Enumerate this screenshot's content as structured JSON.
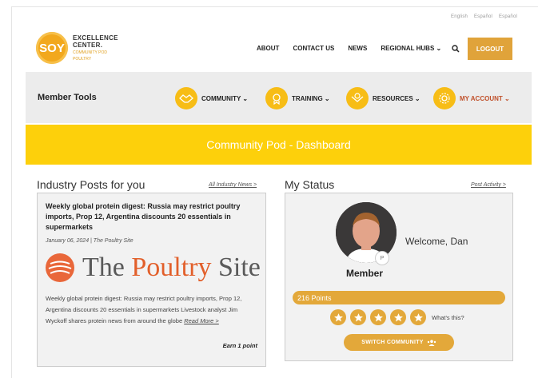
{
  "top_links": [
    "English",
    "Español",
    "Español"
  ],
  "logo": {
    "mark": "SOY",
    "title_line1": "EXCELLENCE",
    "title_line2": "CENTER.",
    "sub_line1": "COMMUNITY POD",
    "sub_line2": "POULTRY"
  },
  "nav": {
    "about": "ABOUT",
    "contact": "CONTACT US",
    "news": "NEWS",
    "regional_hubs": "REGIONAL HUBS ⌄",
    "logout": "LOGOUT"
  },
  "member_tools": {
    "title": "Member Tools",
    "community": "COMMUNITY ⌄",
    "training": "TRAINING ⌄",
    "resources": "RESOURCES ⌄",
    "my_account": "MY ACCOUNT ⌄"
  },
  "banner": {
    "title": "Community Pod - Dashboard"
  },
  "industry_posts": {
    "heading": "Industry Posts for you",
    "all_link": "All Industry News >",
    "post_title": "Weekly global protein digest: Russia may restrict poultry imports, Prop 12, Argentina discounts 20 essentials in supermarkets",
    "meta": "January 06, 2024 | The Poultry Site",
    "source_logo_pre": "The ",
    "source_logo_orange": "Poultry",
    "source_logo_post": " Site",
    "body": "Weekly global protein digest: Russia may restrict poultry imports, Prop 12, Argentina discounts 20 essentials in supermarkets Livestock analyst Jim Wyckoff shares protein news from around the globe ",
    "read_more": "Read More >",
    "earn": "Earn 1 point"
  },
  "my_status": {
    "heading": "My Status",
    "activity_link": "Post Activity >",
    "welcome": "Welcome, Dan",
    "badge": "P",
    "level": "Member",
    "points": "216 Points",
    "stars_filled": 5,
    "whats_this": "What's this?",
    "switch_label": "SWITCH COMMUNITY"
  },
  "colors": {
    "accent": "#e3a83a",
    "banner": "#fdd00b",
    "tools_bg": "#ececec",
    "account_active": "#c0502a"
  }
}
